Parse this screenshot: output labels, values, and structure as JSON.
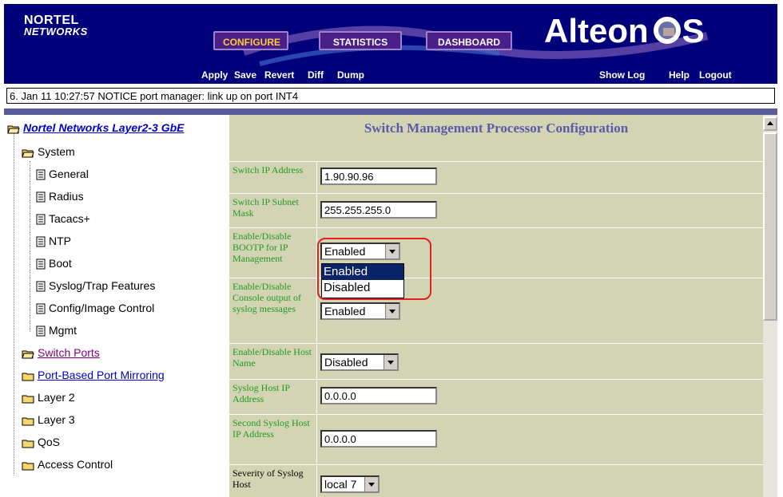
{
  "header": {
    "logo_line1": "NORTEL",
    "logo_line2": "NETWORKS",
    "brand": "Alteon",
    "brand_suffix": "S",
    "nav": [
      "CONFIGURE",
      "STATISTICS",
      "DASHBOARD"
    ],
    "actions": [
      "Apply",
      "Save",
      "Revert",
      "Diff",
      "Dump"
    ],
    "right_links": [
      "Show Log",
      "Help",
      "Logout"
    ]
  },
  "status_message": "6. Jan 11 10:27:57 NOTICE  port manager: link up on port INT4",
  "tree": {
    "root": "Nortel Networks Layer2-3 GbE",
    "system": "System",
    "system_items": [
      "General",
      "Radius",
      "Tacacs+",
      "NTP",
      "Boot",
      "Syslog/Trap Features",
      "Config/Image Control",
      "Mgmt"
    ],
    "folders": [
      "Switch Ports",
      "Port-Based Port Mirroring",
      "Layer 2",
      "Layer 3",
      "QoS",
      "Access Control"
    ]
  },
  "content": {
    "title": "Switch Management Processor Configuration",
    "rows": [
      {
        "label": "Switch IP Address",
        "value": "1.90.90.96"
      },
      {
        "label": "Switch IP Subnet Mask",
        "value": "255.255.255.0"
      },
      {
        "label": "Enable/Disable BOOTP for IP Management",
        "value": "Enabled"
      },
      {
        "label": "Enable/Disable Console output of syslog messages",
        "value": "Enabled"
      },
      {
        "label": "Enable/Disable Host Name",
        "value": "Disabled"
      },
      {
        "label": "Syslog Host IP Address",
        "value": "0.0.0.0"
      },
      {
        "label": "Second Syslog Host IP Address",
        "value": "0.0.0.0"
      },
      {
        "label": "Severity of Syslog Host",
        "value": "local 7"
      }
    ],
    "dropdown_options": [
      "Enabled",
      "Disabled"
    ],
    "dropdown_selected": "Enabled"
  },
  "colors": {
    "header_bg": "#00007a",
    "content_bg": "#d3d4b3",
    "label_green": "#229922",
    "title_blue": "#5a5aaa",
    "highlight_red": "#e02020"
  }
}
